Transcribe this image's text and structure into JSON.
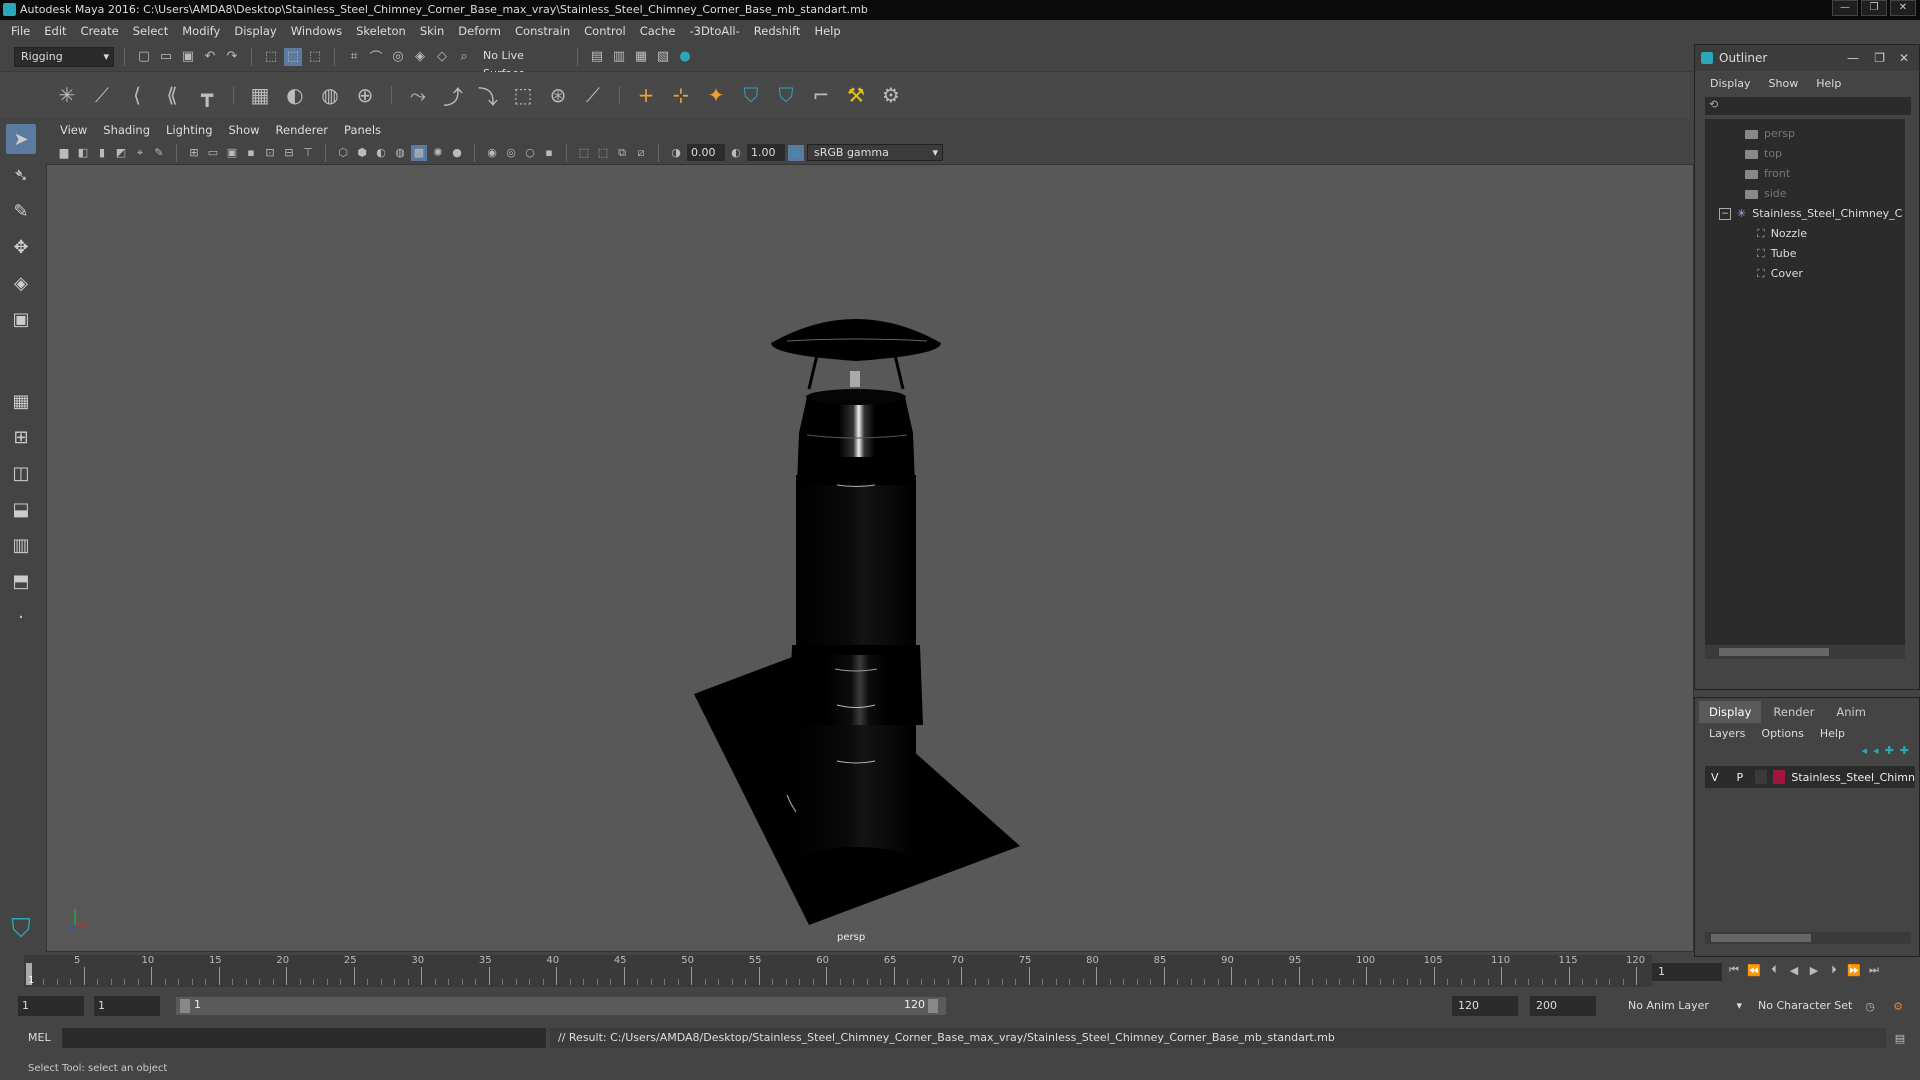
{
  "titlebar": {
    "title": "Autodesk Maya 2016: C:\\Users\\AMDA8\\Desktop\\Stainless_Steel_Chimney_Corner_Base_max_vray\\Stainless_Steel_Chimney_Corner_Base_mb_standart.mb"
  },
  "menubar": [
    "File",
    "Edit",
    "Create",
    "Select",
    "Modify",
    "Display",
    "Windows",
    "Skeleton",
    "Skin",
    "Deform",
    "Constrain",
    "Control",
    "Cache",
    "-3DtoAll-",
    "Redshift",
    "Help"
  ],
  "statusline": {
    "mode": "Rigging",
    "live_surface": "No Live Surface"
  },
  "viewport": {
    "menu": [
      "View",
      "Shading",
      "Lighting",
      "Show",
      "Renderer",
      "Panels"
    ],
    "exposure": "0.00",
    "gamma": "1.00",
    "color_space": "sRGB gamma",
    "camera_label": "persp"
  },
  "timeline": {
    "ticks": [
      "5",
      "10",
      "15",
      "20",
      "25",
      "30",
      "35",
      "40",
      "45",
      "50",
      "55",
      "60",
      "65",
      "70",
      "75",
      "80",
      "85",
      "90",
      "95",
      "100",
      "105",
      "110",
      "115",
      "120"
    ],
    "start_label": "1",
    "current_frame": "1"
  },
  "rangebar": {
    "start": "1",
    "start_inner": "1",
    "range_start": "1",
    "range_end": "120",
    "end_inner": "120",
    "end": "200",
    "anim_layer": "No Anim Layer",
    "character_set": "No Character Set"
  },
  "cmdline": {
    "label": "MEL",
    "result": "// Result: C:/Users/AMDA8/Desktop/Stainless_Steel_Chimney_Corner_Base_max_vray/Stainless_Steel_Chimney_Corner_Base_mb_standart.mb"
  },
  "helpline": {
    "text": "Select Tool: select an object"
  },
  "outliner": {
    "title": "Outliner",
    "menu": [
      "Display",
      "Show",
      "Help"
    ],
    "cameras": [
      "persp",
      "top",
      "front",
      "side"
    ],
    "group": "Stainless_Steel_Chimney_C",
    "children": [
      "Nozzle",
      "Tube",
      "Cover"
    ]
  },
  "layers": {
    "tabs": [
      "Display",
      "Render",
      "Anim"
    ],
    "menu": [
      "Layers",
      "Options",
      "Help"
    ],
    "row": {
      "v": "V",
      "p": "P",
      "name": "Stainless_Steel_Chimn",
      "color": "#a0163a"
    }
  }
}
